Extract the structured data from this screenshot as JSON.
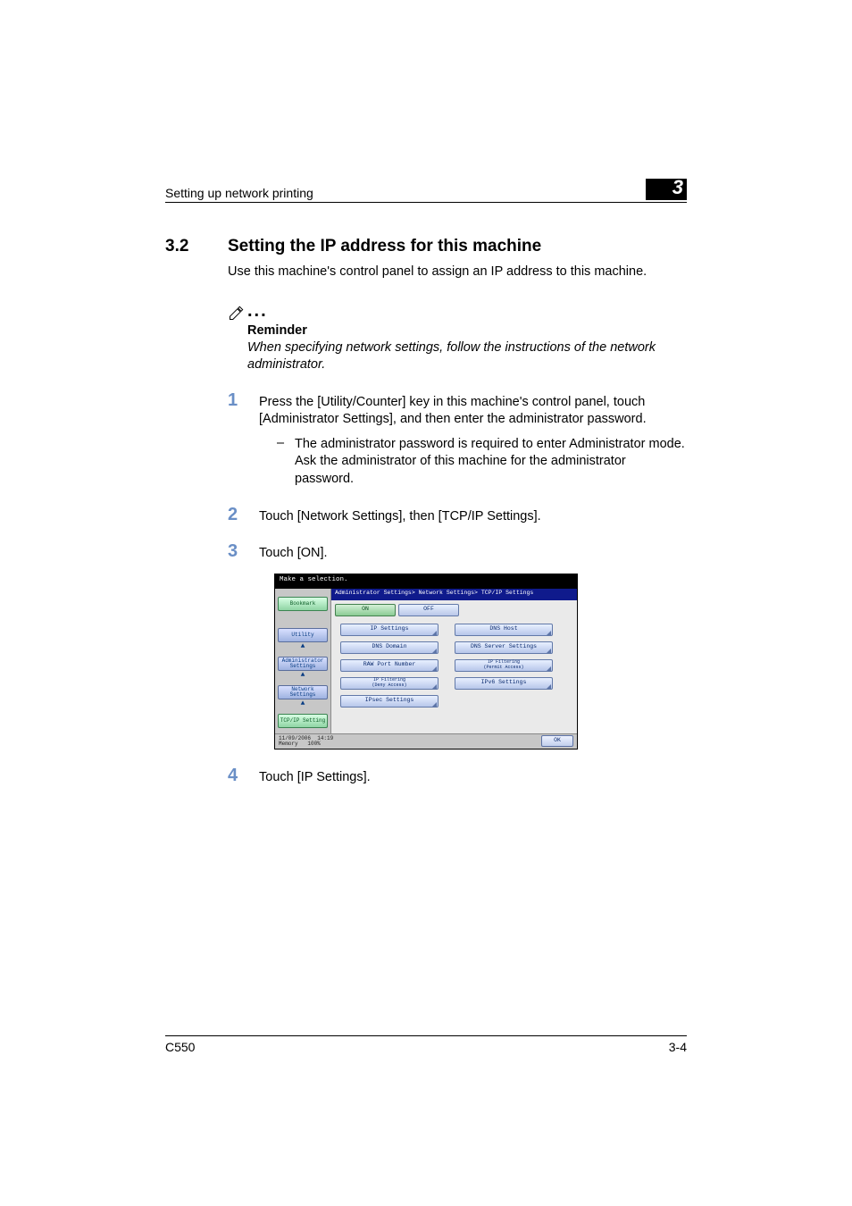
{
  "header": {
    "title": "Setting up network printing",
    "chapter": "3"
  },
  "section": {
    "number": "3.2",
    "title": "Setting the IP address for this machine",
    "intro": "Use this machine's control panel to assign an IP address to this machine."
  },
  "reminder": {
    "label": "Reminder",
    "text": "When specifying network settings, follow the instructions of the network administrator."
  },
  "steps": [
    {
      "num": "1",
      "text": "Press the [Utility/Counter] key in this machine's control panel, touch [Administrator Settings], and then enter the administrator password.",
      "sub": {
        "dash": "–",
        "text": "The administrator password is required to enter Administrator mode. Ask the administrator of this machine for the administrator password."
      }
    },
    {
      "num": "2",
      "text": "Touch [Network Settings], then [TCP/IP Settings]."
    },
    {
      "num": "3",
      "text": "Touch [ON]."
    },
    {
      "num": "4",
      "text": "Touch [IP Settings]."
    }
  ],
  "panel": {
    "top": "Make a selection.",
    "breadcrumb": "Administrator Settings> Network Settings> TCP/IP Settings",
    "crumbs": [
      "Bookmark",
      "Utility",
      "Administrator\nSettings",
      "Network\nSettings",
      "TCP/IP Setting"
    ],
    "seg": {
      "on": "ON",
      "off": "OFF"
    },
    "options_left": [
      "IP Settings",
      "DNS Domain",
      "RAW Port Number",
      "IP Filtering\n(Deny Access)",
      "IPsec Settings"
    ],
    "options_right": [
      "DNS Host",
      "DNS Server Settings",
      "IP Filtering\n(Permit Access)",
      "IPv6 Settings"
    ],
    "status": {
      "date": "11/09/2006",
      "time": "14:19",
      "mem_label": "Memory",
      "mem_val": "100%"
    },
    "ok": "OK"
  },
  "footer": {
    "left": "C550",
    "right": "3-4"
  }
}
